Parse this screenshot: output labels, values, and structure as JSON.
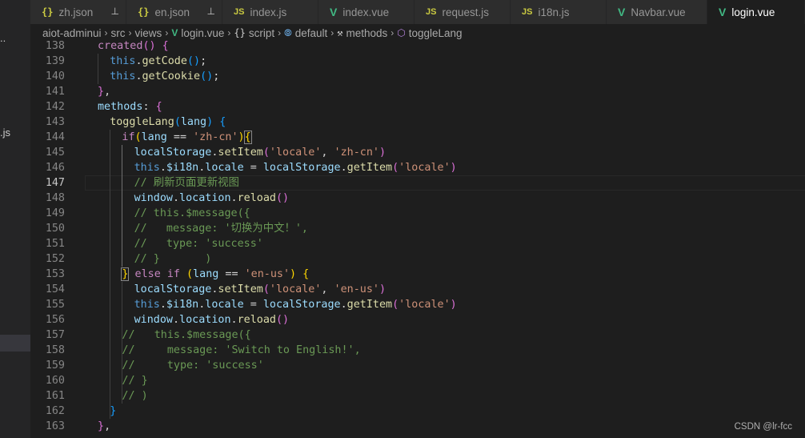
{
  "sidebar": {
    "fragments": [
      "..",
      ".js"
    ]
  },
  "tabs": [
    {
      "label": "zh.json",
      "type": "json",
      "pinned": true
    },
    {
      "label": "en.json",
      "type": "json",
      "pinned": true
    },
    {
      "label": "index.js",
      "type": "js",
      "pinned": false
    },
    {
      "label": "index.vue",
      "type": "vue",
      "pinned": false
    },
    {
      "label": "request.js",
      "type": "js",
      "pinned": false
    },
    {
      "label": "i18n.js",
      "type": "js",
      "pinned": false
    },
    {
      "label": "Navbar.vue",
      "type": "vue",
      "pinned": false
    },
    {
      "label": "login.vue",
      "type": "vue",
      "pinned": false,
      "active": true
    }
  ],
  "breadcrumb": [
    {
      "label": "aiot-adminui"
    },
    {
      "label": "src"
    },
    {
      "label": "views"
    },
    {
      "label": "login.vue",
      "icon": "vue-icon"
    },
    {
      "label": "script",
      "icon": "braces-icon"
    },
    {
      "label": "default",
      "icon": "module-icon"
    },
    {
      "label": "methods",
      "icon": "wrench-icon"
    },
    {
      "label": "toggleLang",
      "icon": "cube-icon"
    }
  ],
  "editor": {
    "current_line": 147,
    "lines": [
      {
        "n": 138,
        "indent": 4,
        "tokens": [
          [
            "kw",
            "created"
          ],
          [
            "b2",
            "()"
          ],
          [
            "p",
            " "
          ],
          [
            "b2",
            "{"
          ]
        ]
      },
      {
        "n": 139,
        "indent": 6,
        "tokens": [
          [
            "th",
            "this"
          ],
          [
            "p",
            "."
          ],
          [
            "fn",
            "getCode"
          ],
          [
            "b3",
            "()"
          ],
          [
            "p",
            ";"
          ]
        ]
      },
      {
        "n": 140,
        "indent": 6,
        "tokens": [
          [
            "th",
            "this"
          ],
          [
            "p",
            "."
          ],
          [
            "fn",
            "getCookie"
          ],
          [
            "b3",
            "()"
          ],
          [
            "p",
            ";"
          ]
        ]
      },
      {
        "n": 141,
        "indent": 4,
        "tokens": [
          [
            "b2",
            "}"
          ],
          [
            "p",
            ","
          ]
        ]
      },
      {
        "n": 142,
        "indent": 4,
        "tokens": [
          [
            "vr",
            "methods"
          ],
          [
            "p",
            ": "
          ],
          [
            "b2",
            "{"
          ]
        ]
      },
      {
        "n": 143,
        "indent": 6,
        "tokens": [
          [
            "fn",
            "toggleLang"
          ],
          [
            "b3",
            "("
          ],
          [
            "vr",
            "lang"
          ],
          [
            "b3",
            ")"
          ],
          [
            "p",
            " "
          ],
          [
            "b3",
            "{"
          ]
        ]
      },
      {
        "n": 144,
        "indent": 8,
        "tokens": [
          [
            "kw",
            "if"
          ],
          [
            "b1",
            "("
          ],
          [
            "vr",
            "lang"
          ],
          [
            "p",
            " == "
          ],
          [
            "st",
            "'zh-cn'"
          ],
          [
            "b1",
            ")"
          ],
          [
            "b1m",
            "{"
          ]
        ]
      },
      {
        "n": 145,
        "indent": 10,
        "tokens": [
          [
            "vr",
            "localStorage"
          ],
          [
            "p",
            "."
          ],
          [
            "fn",
            "setItem"
          ],
          [
            "b2",
            "("
          ],
          [
            "st",
            "'locale'"
          ],
          [
            "p",
            ", "
          ],
          [
            "st",
            "'zh-cn'"
          ],
          [
            "b2",
            ")"
          ]
        ]
      },
      {
        "n": 146,
        "indent": 10,
        "tokens": [
          [
            "th",
            "this"
          ],
          [
            "p",
            "."
          ],
          [
            "vr",
            "$i18n"
          ],
          [
            "p",
            "."
          ],
          [
            "vr",
            "locale"
          ],
          [
            "p",
            " = "
          ],
          [
            "vr",
            "localStorage"
          ],
          [
            "p",
            "."
          ],
          [
            "fn",
            "getItem"
          ],
          [
            "b2",
            "("
          ],
          [
            "st",
            "'locale'"
          ],
          [
            "b2",
            ")"
          ]
        ]
      },
      {
        "n": 147,
        "indent": 10,
        "tokens": [
          [
            "cm",
            "// 刷新页面更新视图"
          ]
        ]
      },
      {
        "n": 148,
        "indent": 10,
        "tokens": [
          [
            "vr",
            "window"
          ],
          [
            "p",
            "."
          ],
          [
            "vr",
            "location"
          ],
          [
            "p",
            "."
          ],
          [
            "fn",
            "reload"
          ],
          [
            "b2",
            "()"
          ]
        ]
      },
      {
        "n": 149,
        "indent": 10,
        "tokens": [
          [
            "cm",
            "// this.$message({"
          ]
        ]
      },
      {
        "n": 150,
        "indent": 10,
        "tokens": [
          [
            "cm",
            "//   message: '切换为中文！',"
          ]
        ]
      },
      {
        "n": 151,
        "indent": 10,
        "tokens": [
          [
            "cm",
            "//   type: 'success'"
          ]
        ]
      },
      {
        "n": 152,
        "indent": 10,
        "tokens": [
          [
            "cm",
            "// }       )"
          ]
        ]
      },
      {
        "n": 153,
        "indent": 8,
        "tokens": [
          [
            "b1m",
            "}"
          ],
          [
            "p",
            " "
          ],
          [
            "kw",
            "else if"
          ],
          [
            "p",
            " "
          ],
          [
            "b1",
            "("
          ],
          [
            "vr",
            "lang"
          ],
          [
            "p",
            " == "
          ],
          [
            "st",
            "'en-us'"
          ],
          [
            "b1",
            ")"
          ],
          [
            "p",
            " "
          ],
          [
            "b1",
            "{"
          ]
        ]
      },
      {
        "n": 154,
        "indent": 10,
        "tokens": [
          [
            "vr",
            "localStorage"
          ],
          [
            "p",
            "."
          ],
          [
            "fn",
            "setItem"
          ],
          [
            "b2",
            "("
          ],
          [
            "st",
            "'locale'"
          ],
          [
            "p",
            ", "
          ],
          [
            "st",
            "'en-us'"
          ],
          [
            "b2",
            ")"
          ]
        ]
      },
      {
        "n": 155,
        "indent": 10,
        "tokens": [
          [
            "th",
            "this"
          ],
          [
            "p",
            "."
          ],
          [
            "vr",
            "$i18n"
          ],
          [
            "p",
            "."
          ],
          [
            "vr",
            "locale"
          ],
          [
            "p",
            " = "
          ],
          [
            "vr",
            "localStorage"
          ],
          [
            "p",
            "."
          ],
          [
            "fn",
            "getItem"
          ],
          [
            "b2",
            "("
          ],
          [
            "st",
            "'locale'"
          ],
          [
            "b2",
            ")"
          ]
        ]
      },
      {
        "n": 156,
        "indent": 10,
        "tokens": [
          [
            "vr",
            "window"
          ],
          [
            "p",
            "."
          ],
          [
            "vr",
            "location"
          ],
          [
            "p",
            "."
          ],
          [
            "fn",
            "reload"
          ],
          [
            "b2",
            "()"
          ]
        ]
      },
      {
        "n": 157,
        "indent": 8,
        "tokens": [
          [
            "cm",
            "//   this.$message({"
          ]
        ]
      },
      {
        "n": 158,
        "indent": 8,
        "tokens": [
          [
            "cm",
            "//     message: 'Switch to English!',"
          ]
        ]
      },
      {
        "n": 159,
        "indent": 8,
        "tokens": [
          [
            "cm",
            "//     type: 'success'"
          ]
        ]
      },
      {
        "n": 160,
        "indent": 8,
        "tokens": [
          [
            "cm",
            "// }"
          ]
        ]
      },
      {
        "n": 161,
        "indent": 8,
        "tokens": [
          [
            "cm",
            "// )"
          ]
        ]
      },
      {
        "n": 162,
        "indent": 6,
        "tokens": [
          [
            "b3",
            "}"
          ]
        ]
      },
      {
        "n": 163,
        "indent": 4,
        "tokens": [
          [
            "b2",
            "}"
          ],
          [
            "p",
            ","
          ]
        ]
      }
    ]
  },
  "watermark": "CSDN @lr-fcc"
}
